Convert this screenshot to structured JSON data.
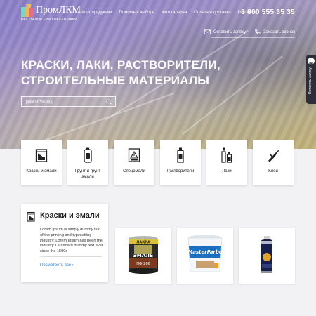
{
  "header": {
    "logo_name": "ПромЛКМ",
    "logo_sub": "РАСТВОРИТЕЛИ КРАСКИ ЛАКИ",
    "nav": [
      "Каталог продукции",
      "Помощь в выборе",
      "Фотогалерея",
      "Оплата и доставка",
      "Контакты"
    ],
    "phone": "8 800 555 35 35"
  },
  "hero": {
    "actions": [
      "Оставить заявку",
      "Заказать звонок"
    ],
    "title_line1": "КРАСКИ, ЛАКИ, РАСТВОРИТЕЛИ,",
    "title_line2": "СТРОИТЕЛЬНЫЕ МАТЕРИАЛЫ",
    "search_value": "[[searchValue]]",
    "side_tab": "Оставить заявку"
  },
  "categories": [
    {
      "label": "Краски и эмали",
      "icon": "paint-can-icon"
    },
    {
      "label": "Грунт и грунт эмали",
      "icon": "primer-can-icon"
    },
    {
      "label": "Спецэмали",
      "icon": "special-enamel-icon"
    },
    {
      "label": "Растворители",
      "icon": "solvent-bottle-icon"
    },
    {
      "label": "Лаки",
      "icon": "varnish-bottles-icon"
    },
    {
      "label": "Клеи",
      "icon": "glue-tube-icon"
    }
  ],
  "featured": {
    "title": "Краски и эмали",
    "text": "Lorem Ipsum is simply dummy text of the printing and typesetting industry. Lorem Ipsum has been the industry's standard dummy text ever since the 1500s",
    "link": "Посмотреть все",
    "icon": "paint-can-icon"
  },
  "products": [
    {
      "icon": "enamel-tin-image",
      "brand": "ЛАКРА",
      "name": "ЭМАЛЬ",
      "code": "ПФ-266"
    },
    {
      "icon": "paint-bucket-image",
      "brand": "MasterFarbe"
    },
    {
      "icon": "spray-can-image"
    }
  ],
  "colors": {
    "accent": "#3a7bd5",
    "dark": "#2e2e3a"
  }
}
